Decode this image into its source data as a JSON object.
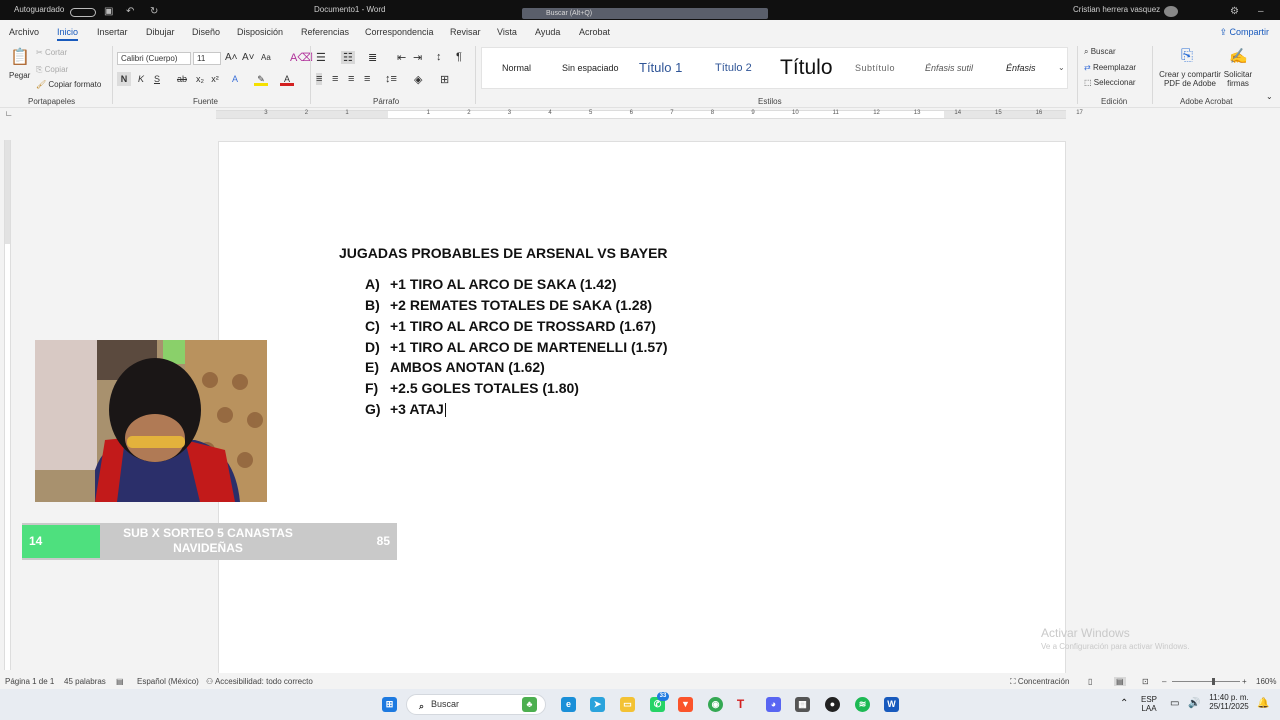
{
  "titlebar": {
    "autosave": "Autoguardado",
    "doc_name": "Documento1 - Word",
    "search": "Buscar (Alt+Q)",
    "user": "Cristian herrera vasquez"
  },
  "tabs": [
    "Archivo",
    "Inicio",
    "Insertar",
    "Dibujar",
    "Diseño",
    "Disposición",
    "Referencias",
    "Correspondencia",
    "Revisar",
    "Vista",
    "Ayuda",
    "Acrobat"
  ],
  "share_label": "Compartir",
  "ribbon": {
    "clipboard": {
      "paste": "Pegar",
      "cut": "Cortar",
      "copy": "Copiar",
      "format_painter": "Copiar formato",
      "group": "Portapapeles"
    },
    "font": {
      "family": "Calibri (Cuerpo)",
      "size": "11",
      "group": "Fuente",
      "aa": "Aa",
      "bold": "N",
      "italic": "K",
      "underline": "S",
      "strike": "ab",
      "sub": "x₂",
      "sup": "x²"
    },
    "paragraph": {
      "group": "Párrafo"
    },
    "styles": {
      "group": "Estilos",
      "items": [
        "Normal",
        "Sin espaciado",
        "Título 1",
        "Título 2",
        "Título",
        "Subtítulo",
        "Énfasis sutil",
        "Énfasis"
      ]
    },
    "editing": {
      "find": "Buscar",
      "replace": "Reemplazar",
      "select": "Seleccionar",
      "group": "Edición"
    },
    "acrobat": {
      "create_line1": "Crear y compartir",
      "create_line2": "PDF de Adobe",
      "request_line1": "Solicitar",
      "request_line2": "firmas",
      "group": "Adobe Acrobat"
    }
  },
  "ruler_numbers": [
    "3",
    "2",
    "1",
    "1",
    "2",
    "3",
    "4",
    "5",
    "6",
    "7",
    "8",
    "9",
    "10",
    "11",
    "12",
    "13",
    "14",
    "15",
    "16",
    "17"
  ],
  "document": {
    "title": "JUGADAS PROBABLES DE ARSENAL VS BAYER",
    "items": [
      {
        "letter": "A)",
        "text": "+1 TIRO AL ARCO DE SAKA (1.42)"
      },
      {
        "letter": "B)",
        "text": "+2 REMATES TOTALES DE SAKA (1.28)"
      },
      {
        "letter": "C)",
        "text": "+1 TIRO AL ARCO DE TROSSARD (1.67)"
      },
      {
        "letter": "D)",
        "text": "+1 TIRO AL ARCO DE MARTENELLI (1.57)"
      },
      {
        "letter": "E)",
        "text": "AMBOS ANOTAN (1.62)"
      },
      {
        "letter": "F)",
        "text": "+2.5 GOLES TOTALES (1.80)"
      },
      {
        "letter": "G)",
        "text": "+3 ATAJ"
      }
    ]
  },
  "stream_overlay": {
    "left": "14",
    "text": "SUB X SORTEO 5 CANASTAS NAVIDEÑAS",
    "right": "85"
  },
  "activation": {
    "line1": "Activar Windows",
    "line2": "Ve a Configuración para activar Windows."
  },
  "statusbar": {
    "page": "Página 1 de 1",
    "words": "45 palabras",
    "language": "Español (México)",
    "accessibility": "Accesibilidad: todo correcto",
    "focus": "Concentración",
    "zoom": "160%",
    "zoom_fraction": 0.6
  },
  "taskbar": {
    "search": "Buscar",
    "whatsapp_badge": "33",
    "lang_line1": "ESP",
    "lang_line2": "LAA",
    "time": "11:40 p. m.",
    "date": "25/11/2025"
  }
}
